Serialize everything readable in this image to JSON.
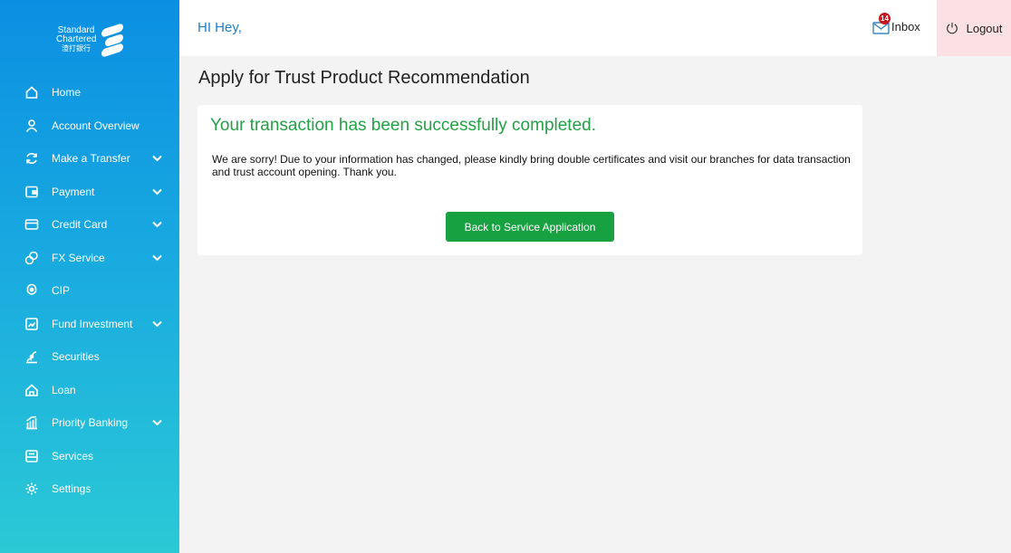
{
  "brand": {
    "line1": "Standard",
    "line2": "Chartered",
    "line3": "渣打銀行"
  },
  "sidebar": {
    "items": [
      {
        "label": "Home",
        "icon": "home-icon",
        "expandable": false
      },
      {
        "label": "Account Overview",
        "icon": "person-icon",
        "expandable": false
      },
      {
        "label": "Make a Transfer",
        "icon": "transfer-icon",
        "expandable": true
      },
      {
        "label": "Payment",
        "icon": "payment-icon",
        "expandable": true
      },
      {
        "label": "Credit Card",
        "icon": "credit-card-icon",
        "expandable": true
      },
      {
        "label": "FX Service",
        "icon": "fx-icon",
        "expandable": true
      },
      {
        "label": "CIP",
        "icon": "cip-icon",
        "expandable": false
      },
      {
        "label": "Fund Investment",
        "icon": "fund-icon",
        "expandable": true
      },
      {
        "label": "Securities",
        "icon": "securities-icon",
        "expandable": false
      },
      {
        "label": "Loan",
        "icon": "loan-icon",
        "expandable": false
      },
      {
        "label": "Priority Banking",
        "icon": "priority-banking-icon",
        "expandable": true
      },
      {
        "label": "Services",
        "icon": "services-icon",
        "expandable": false
      },
      {
        "label": "Settings",
        "icon": "gear-icon",
        "expandable": false
      }
    ]
  },
  "header": {
    "greeting": "HI Hey,",
    "inbox_label": "Inbox",
    "inbox_badge": "14",
    "logout_label": "Logout"
  },
  "main": {
    "title": "Apply for Trust Product Recommendation",
    "success_title": "Your transaction has been successfully completed.",
    "message": "We are sorry!  Due to your information has changed, please kindly bring double certificates and visit our branches for data transaction and trust account opening. Thank you.",
    "back_button": "Back to Service Application"
  },
  "colors": {
    "sidebar_top": "#0b8fe2",
    "sidebar_bottom": "#2bc9d6",
    "greeting": "#1a7fd1",
    "success": "#24a145",
    "button": "#18a141",
    "logout_bg": "#fbe1e3",
    "badge": "#c4161c"
  }
}
